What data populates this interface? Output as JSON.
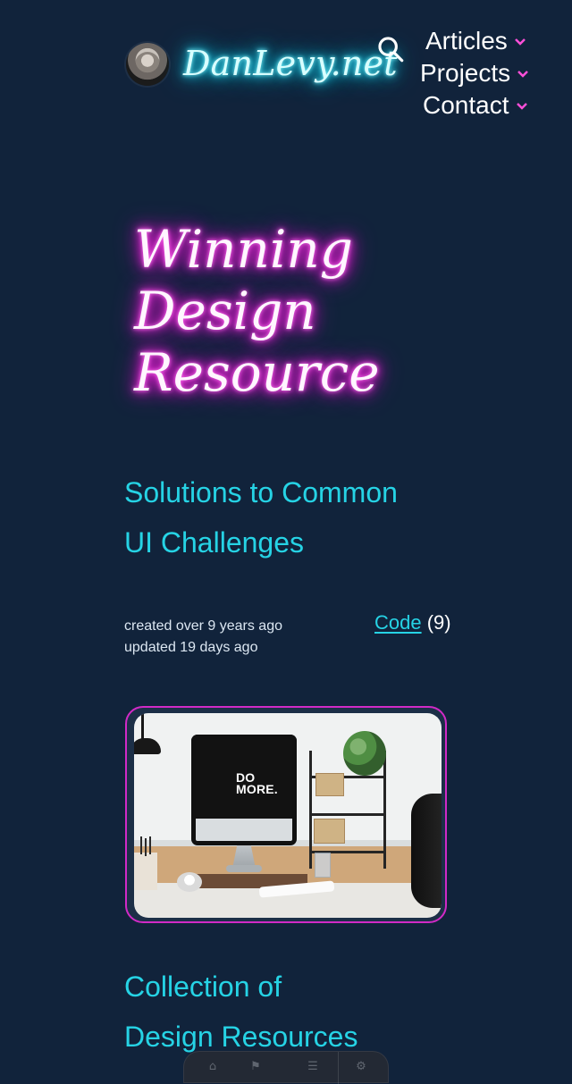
{
  "site": {
    "brand": "DanLevy.net",
    "accent_cyan": "#26d3e5",
    "accent_magenta": "#ff37e6",
    "background": "#11233b"
  },
  "header": {
    "search_icon": "search-icon",
    "nav": [
      {
        "label": "Articles",
        "icon": "chevron-down-icon"
      },
      {
        "label": "Projects",
        "icon": "chevron-down-icon"
      },
      {
        "label": "Contact",
        "icon": "chevron-down-icon"
      }
    ]
  },
  "hero": {
    "lines": [
      "Winning",
      "Design",
      "Resource"
    ]
  },
  "sections": [
    {
      "title_lines": [
        "Solutions to Common",
        "UI Challenges"
      ]
    },
    {
      "title_lines": [
        "Collection of",
        "Design Resources"
      ]
    }
  ],
  "meta": {
    "created": "created over 9 years ago",
    "updated": "updated 19 days ago",
    "tag_label": "Code",
    "tag_count": "(9)"
  },
  "image": {
    "screen_text_line1": "DO",
    "screen_text_line2": "MORE."
  }
}
